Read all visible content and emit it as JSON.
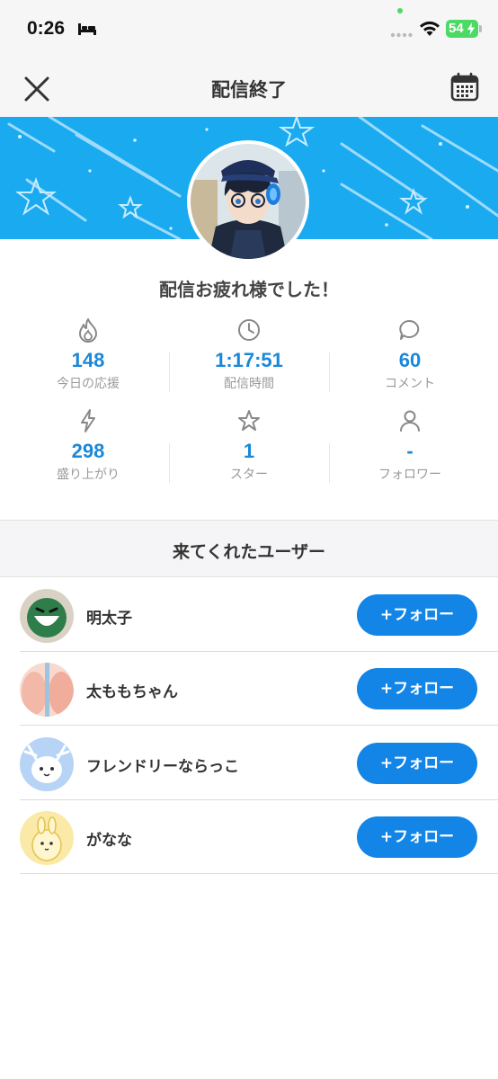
{
  "status_bar": {
    "time": "0:26",
    "battery": "54"
  },
  "header": {
    "title": "配信終了"
  },
  "greeting": "配信お疲れ様でした！",
  "stats": [
    {
      "icon": "flame-icon",
      "value": "148",
      "label": "今日の応援"
    },
    {
      "icon": "clock-icon",
      "value": "1:17:51",
      "label": "配信時間"
    },
    {
      "icon": "comment-bubble-icon",
      "value": "60",
      "label": "コメント"
    },
    {
      "icon": "lightning-icon",
      "value": "298",
      "label": "盛り上がり"
    },
    {
      "icon": "star-icon",
      "value": "1",
      "label": "スター"
    },
    {
      "icon": "person-icon",
      "value": "-",
      "label": "フォロワー"
    }
  ],
  "visitors": {
    "heading": "来てくれたユーザー",
    "follow_label": "+フォロー",
    "users": [
      {
        "name": "明太子"
      },
      {
        "name": "太ももちゃん"
      },
      {
        "name": "フレンドリーならっこ"
      },
      {
        "name": "がなな"
      }
    ]
  },
  "colors": {
    "accent": "#1285e6",
    "banner": "#1aaaf0",
    "stat_value": "#1a88d8"
  }
}
